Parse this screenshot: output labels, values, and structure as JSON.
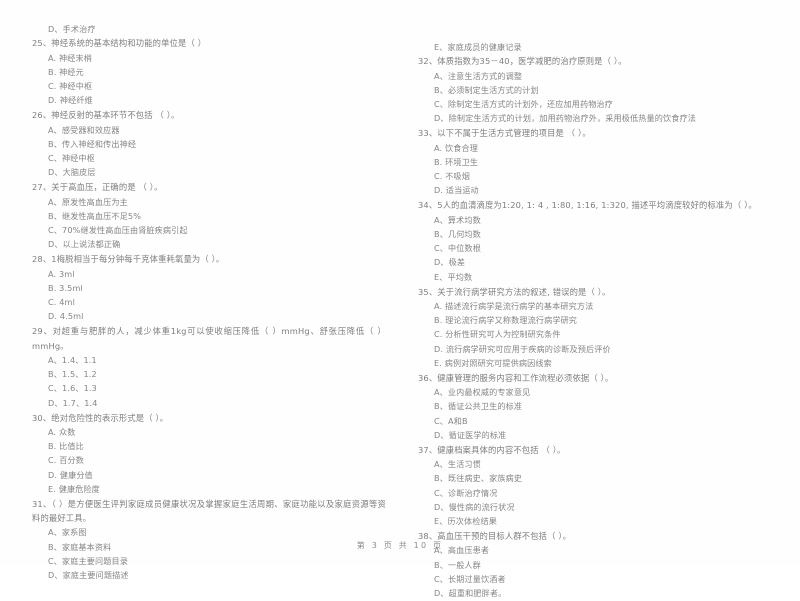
{
  "document": {
    "type": "scanned-exam-paper",
    "language": "zh-CN",
    "footer": "第 3 页 共 10 页"
  },
  "left_column": {
    "lead_option": "D、手术治疗",
    "questions": [
      {
        "number": "25",
        "stem": "25、神经系统的基本结构和功能的单位是（      ）",
        "options": [
          "A. 神经末梢",
          "B. 神经元",
          "C. 神经中枢",
          "D. 神经纤维"
        ]
      },
      {
        "number": "26",
        "stem": "26、神经反射的基本环节不包括 （      ）。",
        "options": [
          "A、感受器和效应器",
          "B、传入神经和传出神经",
          "C、神经中枢",
          "D、大脑皮层"
        ]
      },
      {
        "number": "27",
        "stem": "27、关于高血压，正确的是 （      ）。",
        "options": [
          "A、原发性高血压为主",
          "B、继发性高血压不足5%",
          "C、70%继发性高血压由肾脏疾病引起",
          "D、以上说法都正确"
        ]
      },
      {
        "number": "28",
        "stem": "28、1梅脱相当于每分钟每千克体重耗氧量为（      ）。",
        "options": [
          "A. 3ml",
          "B. 3.5ml",
          "C. 4ml",
          "D. 4.5ml"
        ]
      },
      {
        "number": "29",
        "stem": "29、对超重与肥胖的人，减少体重1kg可以使收缩压降低（      ）mmHg、舒张压降低（      ）mmHg。",
        "options": [
          "A、1.4、1.1",
          "B、1.5、1.2",
          "C、1.6、1.3",
          "D、1.7、1.4"
        ]
      },
      {
        "number": "30",
        "stem": "30、绝对危险性的表示形式是（      ）。",
        "options": [
          "A. 众数",
          "B. 比值比",
          "C. 百分数",
          "D. 健康分值",
          "E. 健康危险度"
        ]
      },
      {
        "number": "31",
        "stem": "31、（         ）是方便医生评判家庭成员健康状况及掌握家庭生活周期、家庭功能以及家庭资源等资料的最好工具。",
        "options": [
          "A、家系图",
          "B、家庭基本资料",
          "C、家庭主要问题目录",
          "D、家庭主要问题描述"
        ]
      }
    ]
  },
  "right_column": {
    "lead_option": "E、家庭成员的健康记录",
    "questions": [
      {
        "number": "32",
        "stem": "32、体质指数为35－40，医学减肥的治疗原则是（       ）。",
        "options": [
          "A、注意生活方式的调整",
          "B、必须制定生活方式的计划",
          "C、除制定生活方式的计划外，还应加用药物治疗",
          "D、除制定生活方式的计划，加用药物治疗外，采用极低热量的饮食疗法"
        ]
      },
      {
        "number": "33",
        "stem": "33、以下不属于生活方式管理的项目是 （      ）。",
        "options": [
          "A. 饮食合理",
          "B. 环境卫生",
          "C. 不吸烟",
          "D. 适当运动"
        ]
      },
      {
        "number": "34",
        "stem": "34、5人的血清滴度为1:20, 1: 4 , 1:80, 1:16, 1:320, 描述平均滴度较好的标准为（      ）。",
        "options": [
          "A、算术均数",
          "B、几何均数",
          "C、中位数根",
          "D、极差",
          "E、平均数"
        ]
      },
      {
        "number": "35",
        "stem": "35、关于流行病学研究方法的叙述, 错误的是（      ）。",
        "options": [
          "A. 描述流行病学是流行病学的基本研究方法",
          "B. 理论流行病学又称数理流行病学研究",
          "C. 分析性研究可人为控制研究条件",
          "D. 流行病学研究可应用于疾病的诊断及预后评价",
          "E. 病例对照研究可提供病因线索"
        ]
      },
      {
        "number": "36",
        "stem": "36、健康管理的服务内容和工作流程必须依据（        ）。",
        "options": [
          "A、业内最权威的专家意见",
          "B、循证公共卫生的标准",
          "C、A和B",
          "D、循证医学的标准"
        ]
      },
      {
        "number": "37",
        "stem": "37、健康档案具体的内容不包括 （      ）。",
        "options": [
          "A、生活习惯",
          "B、既往病史、家族病史",
          "C、诊断治疗情况",
          "D、慢性病的流行状况",
          "E、历次体检结果"
        ]
      },
      {
        "number": "38",
        "stem": "38、高血压干预的目标人群不包括（      ）。",
        "options": [
          "A、高血压患者",
          "B、一般人群",
          "C、长期过量饮酒者",
          "D、超重和肥胖者。"
        ]
      }
    ]
  }
}
